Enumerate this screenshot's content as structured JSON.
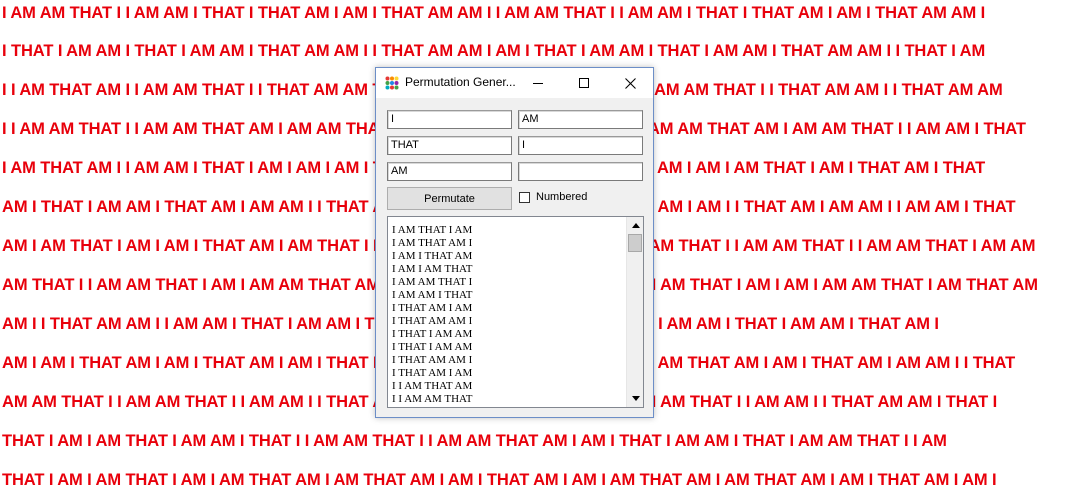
{
  "background_lines": [
    "I AM AM THAT I I AM AM I THAT I THAT AM I AM I THAT AM AM I I AM AM THAT I I AM AM I THAT I THAT AM I AM I THAT AM AM I",
    "I THAT I AM AM I THAT I AM AM I THAT AM AM I I THAT AM AM I AM I THAT I AM AM I THAT I AM AM I THAT AM AM I I THAT I AM",
    "I I AM THAT AM I I AM AM THAT I I THAT AM AM THAT I AM I THAT I AM AM I THAT I I AM AM THAT I I THAT AM AM I I THAT AM AM",
    "I I AM AM THAT I I AM AM THAT AM I AM AM THAT I AM AM THAT I AM AM I THAT I I AM AM THAT AM I AM AM THAT I I AM AM I THAT",
    "I AM THAT AM I I AM AM I THAT I AM I AM I AM I THAT AM I AM THAT AM I THAT AM I AM I AM I AM THAT I AM I THAT AM I THAT",
    "AM I THAT I AM AM I THAT AM I AM AM I I THAT AM I AM THAT I AM AM I AM I THAT I AM I AM I I THAT AM I AM AM I I AM AM I THAT",
    "AM I AM THAT I AM I AM I THAT AM I AM THAT I I AM THAT AM I AM AM I THAT AM I AM THAT I I AM AM THAT I I AM AM THAT I AM AM",
    "AM THAT I I AM AM THAT I AM I AM AM THAT AM I AM AM THAT I I AM THAT AM I AM AM THAT I AM I AM I AM AM THAT I AM THAT AM I I",
    "AM I I THAT AM AM I I AM AM I THAT I AM AM I THAT I AM THAT AM I I AM AM I THAT I AM AM I THAT I AM AM I THAT AM I",
    "AM I AM I THAT AM I AM I THAT AM I AM I THAT I AM AM THAT I AM I AM I THAT AM I AM THAT AM I AM I THAT AM I AM AM I I THAT",
    "AM AM THAT I I AM AM THAT I I AM AM I I THAT AM I AM AM THAT AM AM I THAT AM AM THAT I I AM AM I I THAT AM AM I THAT I",
    "THAT I AM I AM THAT I AM AM I THAT I I AM AM THAT I I AM AM THAT AM I AM I THAT I AM AM I THAT I AM AM THAT I I AM",
    "THAT I AM I AM THAT I AM I AM THAT AM I AM THAT AM I AM I THAT AM I AM I AM THAT AM I AM THAT AM I AM I THAT AM I AM I"
  ],
  "window": {
    "title": "Permutation Gener...",
    "controls": {
      "minimize": "minimize",
      "maximize": "maximize",
      "close": "close"
    }
  },
  "inputs": {
    "field1": "I",
    "field2": "AM",
    "field3": "THAT",
    "field4": "I",
    "field5": "AM",
    "field6": ""
  },
  "permutate_button": "Permutate",
  "numbered_checkbox": {
    "label": "Numbered",
    "checked": false
  },
  "results": [
    "I AM THAT I AM",
    "I AM THAT AM I",
    "I AM I THAT AM",
    "I AM I AM THAT",
    "I AM AM THAT I",
    "I AM AM I THAT",
    "I THAT AM I AM",
    "I THAT AM AM I",
    "I THAT I AM AM",
    "I THAT I AM AM",
    "I THAT AM AM I",
    "I THAT AM I AM",
    "I I AM THAT AM",
    "I I AM AM THAT"
  ],
  "colors": {
    "text_red": "#e8000b",
    "window_border": "#6c8ec7"
  }
}
